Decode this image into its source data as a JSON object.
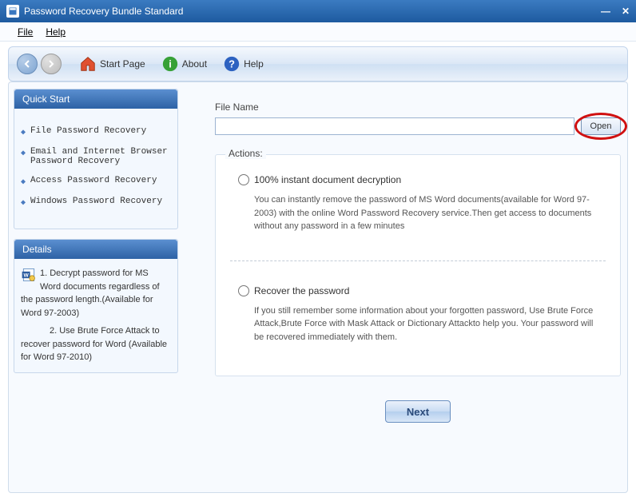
{
  "title": "Password Recovery Bundle Standard",
  "menubar": {
    "file": "File",
    "help": "Help"
  },
  "toolbar": {
    "start": "Start Page",
    "about": "About",
    "help": "Help"
  },
  "sidebar": {
    "quick_start_header": "Quick Start",
    "items": [
      "File Password Recovery",
      "Email and Internet Browser Password Recovery",
      "Access Password Recovery",
      "Windows Password Recovery"
    ],
    "details_header": "Details",
    "details_1": "1. Decrypt password for MS Word documents regardless of the password length.(Available for Word 97-2003)",
    "details_2": "2. Use Brute Force Attack to recover password for Word (Available for Word 97-2010)"
  },
  "main": {
    "file_name_label": "File Name",
    "open_label": "Open",
    "actions_legend": "Actions:",
    "option1": {
      "label": "100% instant document decryption",
      "desc": "You can instantly remove the password of MS Word documents(available for Word 97-2003) with the online Word Password Recovery service.Then get access to documents without any password in a few minutes"
    },
    "option2": {
      "label": "Recover the password",
      "desc": "If you still remember some information about your forgotten password, Use Brute Force Attack,Brute Force with Mask Attack or Dictionary Attackto help you. Your password will be recovered immediately with them."
    },
    "next_label": "Next"
  }
}
